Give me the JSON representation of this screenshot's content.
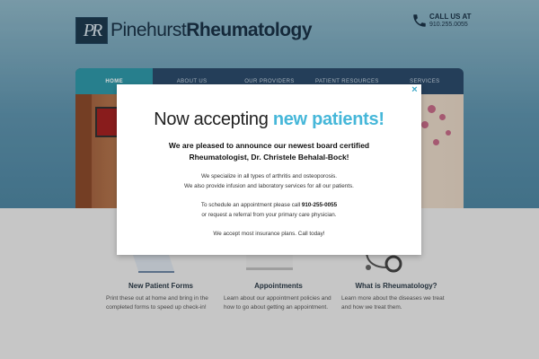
{
  "header": {
    "logo_mark": "PR",
    "logo_light": "Pinehurst",
    "logo_bold": "Rheumatology",
    "call_label": "CALL US AT",
    "call_number": "910.255.0055"
  },
  "nav": {
    "items": [
      {
        "label": "HOME",
        "active": true
      },
      {
        "label": "ABOUT US",
        "active": false
      },
      {
        "label": "OUR PROVIDERS",
        "active": false
      },
      {
        "label": "PATIENT RESOURCES",
        "active": false
      },
      {
        "label": "SERVICES",
        "active": false
      }
    ]
  },
  "cards": [
    {
      "title": "New Patient Forms",
      "text": "Print these out at home and bring in the completed forms to speed up check-in!"
    },
    {
      "title": "Appointments",
      "text": "Learn about our appointment policies and how to go about getting an appointment."
    },
    {
      "title": "What is Rheumatology?",
      "text": "Learn more about the diseases we treat and how we treat them."
    }
  ],
  "modal": {
    "close": "×",
    "title_plain": "Now accepting ",
    "title_accent": "new patients!",
    "announce_line1": "We are pleased to announce our newest board certified",
    "announce_line2": "Rheumatologist, Dr. Christele Behalal-Bock!",
    "services_line1": "We specialize in all types of arthritis and osteoporosis.",
    "services_line2": "We also provide infusion and laboratory services for all our patients.",
    "schedule_prefix": "To schedule an appointment please call ",
    "schedule_phone": "910-255-0055",
    "schedule_line2": "or request a referral from your primary care physician.",
    "insurance": "We accept most insurance plans. Call today!"
  },
  "colors": {
    "accent": "#46b7d9",
    "nav_bg": "#2b4a6a",
    "nav_active": "#2f98a8"
  }
}
